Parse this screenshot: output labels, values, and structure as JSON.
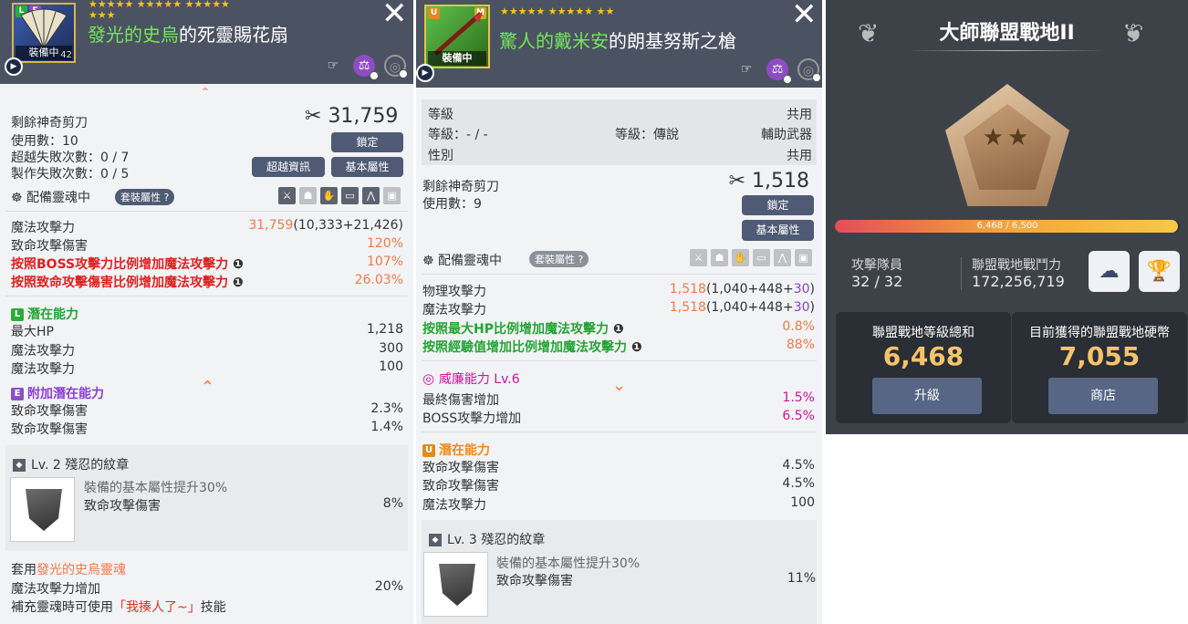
{
  "panel1": {
    "grade_l": "L",
    "grade_e": "E",
    "equipped_tag": "裝備中",
    "level_num": "42",
    "stars_row1": "★★★★★ ★★★★★ ★★★★★",
    "stars_row2": "★★★",
    "title_highlight": "發光的史烏",
    "title_rest": "的死靈賜花扇",
    "scissors_label": "剩餘神奇剪刀",
    "scissors_value": "31,759",
    "uses": "使用數：10",
    "exceed_fail": "超越失敗次數：0 / 7",
    "craft_fail": "製作失敗次數：0 / 5",
    "lock_btn": "鎖定",
    "exceed_info_btn": "超越資訊",
    "base_attr_btn": "基本屬性",
    "soul_label": "配備靈魂中",
    "set_attr": "套裝屬性",
    "stats": [
      {
        "label": "魔法攻擊力",
        "value": "31,759",
        "extra": "(10,333+21,426)"
      },
      {
        "label": "致命攻擊傷害",
        "value": "120%"
      },
      {
        "label": "按照BOSS攻擊力比例增加魔法攻擊力",
        "value": "107%"
      },
      {
        "label": "按照致命攻擊傷害比例增加魔法攻擊力",
        "value": "26.03%"
      }
    ],
    "potential_badge": "L",
    "potential_title": "潛在能力",
    "potential": [
      {
        "label": "最大HP",
        "value": "1,218"
      },
      {
        "label": "魔法攻擊力",
        "value": "300"
      },
      {
        "label": "魔法攻擊力",
        "value": "100"
      }
    ],
    "add_potential_badge": "E",
    "add_potential_title": "附加潛在能力",
    "add_potential": [
      {
        "label": "致命攻擊傷害",
        "value": "2.3%"
      },
      {
        "label": "致命攻擊傷害",
        "value": "1.4%"
      }
    ],
    "emblem_title": "Lv. 2 殘忍的紋章",
    "emblem_desc": "裝備的基本屬性提升30%",
    "emblem_stat": "致命攻擊傷害",
    "emblem_value": "8%",
    "soul_apply_prefix": "套用",
    "soul_apply_name": "發光的史烏靈魂",
    "soul_apply_suffix": "",
    "soul_stat": "魔法攻擊力增加",
    "soul_value": "20%",
    "soul_skill_prefix": "補充靈魂時可使用",
    "soul_skill_name": "「我揍人了~」",
    "soul_skill_suffix": "技能"
  },
  "panel2": {
    "grade_u": "U",
    "grade_m": "M",
    "equipped_tag": "裝備中",
    "stars": "★★★★★ ★★★★★ ★★",
    "title_highlight": "驚人的戴米安",
    "title_rest": "的朗基努斯之槍",
    "level_label": "等級",
    "level_value": "共用",
    "level_row": "等級：- / -",
    "grade_row": "等級：傳說",
    "category": "輔助武器",
    "gender_label": "性別",
    "gender_value": "共用",
    "scissors_label": "剩餘神奇剪刀",
    "scissors_value": "1,518",
    "uses": "使用數：9",
    "lock_btn": "鎖定",
    "base_attr_btn": "基本屬性",
    "soul_label": "配備靈魂中",
    "set_attr": "套裝屬性",
    "stats": [
      {
        "label": "物理攻擊力",
        "value": "1,518",
        "extra": "(1,040+448+",
        "bonus": "30",
        "close": ")"
      },
      {
        "label": "魔法攻擊力",
        "value": "1,518",
        "extra": "(1,040+448+",
        "bonus": "30",
        "close": ")"
      },
      {
        "label": "按照最大HP比例增加魔法攻擊力",
        "value": "0.8%"
      },
      {
        "label": "按照經驗值增加比例增加魔法攻擊力",
        "value": "88%"
      }
    ],
    "power_title": "威廉能力 Lv.6",
    "power": [
      {
        "label": "最終傷害增加",
        "value": "1.5%"
      },
      {
        "label": "BOSS攻擊力增加",
        "value": "6.5%"
      }
    ],
    "potential_badge": "U",
    "potential_title": "潛在能力",
    "potential": [
      {
        "label": "致命攻擊傷害",
        "value": "4.5%"
      },
      {
        "label": "致命攻擊傷害",
        "value": "4.5%"
      },
      {
        "label": "魔法攻擊力",
        "value": "100"
      }
    ],
    "emblem_title": "Lv. 3 殘忍的紋章",
    "emblem_desc": "裝備的基本屬性提升30%",
    "emblem_stat": "致命攻擊傷害",
    "emblem_value": "11%"
  },
  "panel3": {
    "title": "大師聯盟戰地II",
    "xp_text": "6,468 / 6,500",
    "xp_fraction": 0.995,
    "members_label": "攻擊隊員",
    "members_value": "32 / 32",
    "power_label": "聯盟戰地戰鬥力",
    "power_value": "172,256,719",
    "level_sum_label": "聯盟戰地等級總和",
    "level_sum_value": "6,468",
    "upgrade_btn": "升級",
    "coins_label": "目前獲得的聯盟戰地硬幣",
    "coins_value": "7,055",
    "shop_btn": "商店"
  }
}
